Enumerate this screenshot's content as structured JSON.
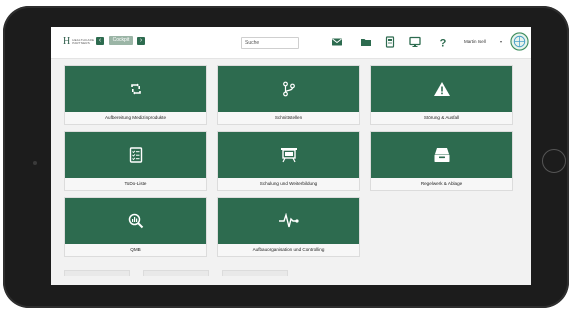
{
  "header": {
    "logo_mark": "H",
    "logo_text_1": "HEALTHCARE",
    "logo_text_2": "PARTNERS",
    "nav_back_label": "‹",
    "nav_forward_label": "›",
    "cockpit_label": "Cockpit",
    "search_placeholder": "Suche",
    "user_name": "Martin Isell",
    "user_caret": "▾",
    "icons": [
      "mail-icon",
      "folder-icon",
      "document-icon",
      "monitor-icon",
      "help-icon"
    ]
  },
  "cards": [
    {
      "label": "Aufbereitung Medizinprodukte",
      "icon": "refresh-arrows-icon"
    },
    {
      "label": "Schnittstellen",
      "icon": "branch-icon"
    },
    {
      "label": "Störung & Ausfall",
      "icon": "warning-icon"
    },
    {
      "label": "ToDo-Liste",
      "icon": "checklist-icon"
    },
    {
      "label": "Schulung und Weiterbildung",
      "icon": "presentation-board-icon"
    },
    {
      "label": "Regelwerk & Ablage",
      "icon": "archive-box-icon"
    },
    {
      "label": "QMB",
      "icon": "analytics-search-icon"
    },
    {
      "label": "Aufbauorganisation und Controlling",
      "icon": "heartbeat-icon"
    }
  ],
  "colors": {
    "brand_green": "#2d6b4f",
    "background": "#f2f2f2"
  }
}
